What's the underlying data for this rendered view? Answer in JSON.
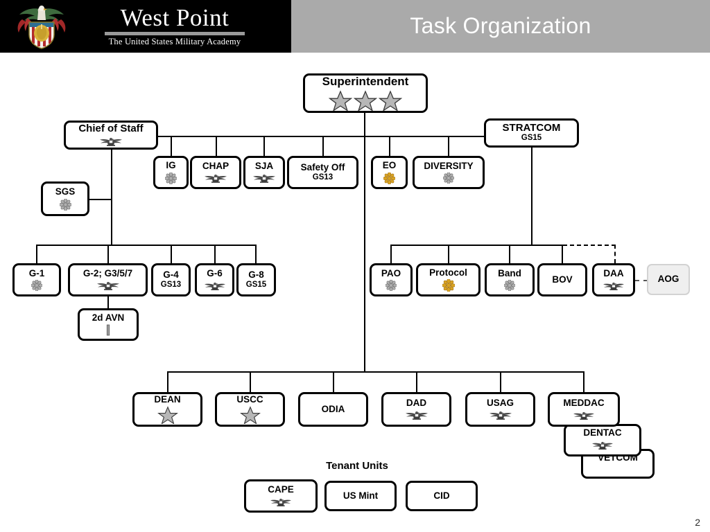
{
  "header": {
    "title": "Task Organization",
    "brand_name": "West Point",
    "brand_subtitle": "The United States Military Academy",
    "crest_icon": "west-point-crest-icon",
    "bg_left": "#000000",
    "bg_right": "#aaaaaa",
    "title_color": "#ffffff"
  },
  "page": {
    "number": "2"
  },
  "tenant": {
    "heading": "Tenant Units"
  },
  "colors": {
    "box_border": "#000000",
    "box_fill": "#ffffff",
    "ghost_fill": "#efefef",
    "ghost_border": "#d2d2d2",
    "silver": "#b4b4b4",
    "gold": "#d9a423",
    "line": "#000000"
  },
  "nodes": {
    "superintendent": {
      "label": "Superintendent",
      "sub": "",
      "insignia": "three-silver-stars",
      "rank_count": 3
    },
    "chief_of_staff": {
      "label": "Chief of Staff",
      "sub": "",
      "insignia": "silver-eagle"
    },
    "sgs": {
      "label": "SGS",
      "sub": "",
      "insignia": "silver-oak-leaf"
    },
    "ig": {
      "label": "IG",
      "sub": "",
      "insignia": "silver-oak-leaf"
    },
    "chap": {
      "label": "CHAP",
      "sub": "",
      "insignia": "silver-eagle"
    },
    "sja": {
      "label": "SJA",
      "sub": "",
      "insignia": "silver-eagle"
    },
    "safety_off": {
      "label": "Safety Off",
      "sub": "GS13",
      "insignia": "none"
    },
    "eo": {
      "label": "EO",
      "sub": "",
      "insignia": "gold-oak-leaf"
    },
    "diversity": {
      "label": "DIVERSITY",
      "sub": "",
      "insignia": "silver-oak-leaf"
    },
    "stratcom": {
      "label": "STRATCOM",
      "sub": "GS15",
      "insignia": "none"
    },
    "g1": {
      "label": "G-1",
      "sub": "",
      "insignia": "silver-oak-leaf"
    },
    "g2_g357": {
      "label": "G-2; G3/5/7",
      "sub": "",
      "insignia": "silver-eagle"
    },
    "g4": {
      "label": "G-4",
      "sub": "GS13",
      "insignia": "none"
    },
    "g6": {
      "label": "G-6",
      "sub": "",
      "insignia": "silver-eagle"
    },
    "g8": {
      "label": "G-8",
      "sub": "GS15",
      "insignia": "none"
    },
    "avn_2d": {
      "label": "2d AVN",
      "sub": "",
      "insignia": "silver-bar"
    },
    "pao": {
      "label": "PAO",
      "sub": "",
      "insignia": "silver-oak-leaf"
    },
    "protocol": {
      "label": "Protocol",
      "sub": "",
      "insignia": "gold-oak-leaf"
    },
    "band": {
      "label": "Band",
      "sub": "",
      "insignia": "silver-oak-leaf"
    },
    "bov": {
      "label": "BOV",
      "sub": "",
      "insignia": "none"
    },
    "daa": {
      "label": "DAA",
      "sub": "",
      "insignia": "silver-eagle"
    },
    "aog": {
      "label": "AOG",
      "sub": "",
      "insignia": "none"
    },
    "dean": {
      "label": "DEAN",
      "sub": "",
      "insignia": "one-silver-star",
      "rank_count": 1
    },
    "uscc": {
      "label": "USCC",
      "sub": "",
      "insignia": "one-silver-star",
      "rank_count": 1
    },
    "odia": {
      "label": "ODIA",
      "sub": "",
      "insignia": "none"
    },
    "dad": {
      "label": "DAD",
      "sub": "",
      "insignia": "silver-eagle"
    },
    "usag": {
      "label": "USAG",
      "sub": "",
      "insignia": "silver-eagle"
    },
    "meddac": {
      "label": "MEDDAC",
      "sub": "",
      "insignia": "silver-eagle"
    },
    "dentac": {
      "label": "DENTAC",
      "sub": "",
      "insignia": "silver-eagle"
    },
    "vetcom": {
      "label": "VETCOM",
      "sub": "",
      "insignia": "none"
    },
    "cape": {
      "label": "CAPE",
      "sub": "",
      "insignia": "silver-eagle"
    },
    "us_mint": {
      "label": "US Mint",
      "sub": "",
      "insignia": "none"
    },
    "cid": {
      "label": "CID",
      "sub": "",
      "insignia": "none"
    }
  }
}
